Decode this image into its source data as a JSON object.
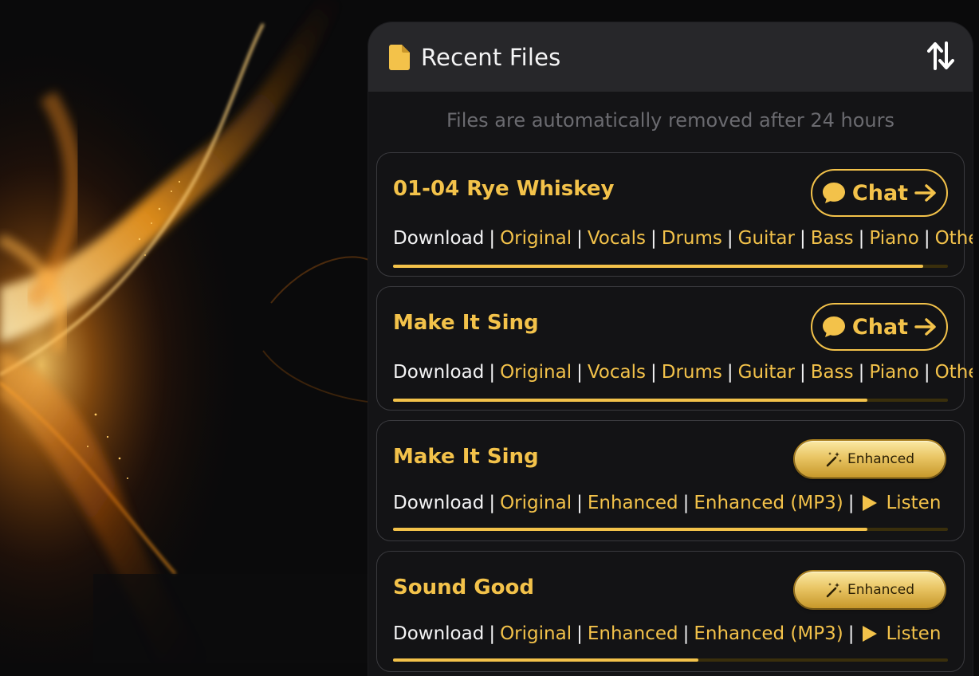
{
  "panel": {
    "title": "Recent Files",
    "notice": "Files are automatically removed after 24 hours"
  },
  "icons": {
    "file": "file-icon",
    "sort": "sort-arrows-icon",
    "chat": "chat-bubble-icon",
    "arrow": "arrow-right-icon",
    "wand": "magic-wand-icon",
    "play": "play-icon"
  },
  "colors": {
    "accent": "#f3c24a",
    "card_border": "#3a3a3e",
    "header_bg": "#27272a"
  },
  "files": [
    {
      "title": "01-04 Rye Whiskey",
      "action": "Chat",
      "links": {
        "download": "Download",
        "original": "Original",
        "vocals": "Vocals",
        "drums": "Drums",
        "guitar": "Guitar",
        "bass": "Bass",
        "piano": "Piano",
        "other": "Other"
      },
      "progress": 0.955
    },
    {
      "title": "Make It Sing",
      "action": "Chat",
      "links": {
        "download": "Download",
        "original": "Original",
        "vocals": "Vocals",
        "drums": "Drums",
        "guitar": "Guitar",
        "bass": "Bass",
        "piano": "Piano",
        "other": "Other"
      },
      "progress": 0.855
    },
    {
      "title": "Make It Sing",
      "badge": "Enhanced",
      "links": {
        "download": "Download",
        "original": "Original",
        "enhanced": "Enhanced",
        "enhanced_mp3": "Enhanced (MP3)",
        "listen": "Listen"
      },
      "progress": 0.855
    },
    {
      "title": "Sound Good",
      "badge": "Enhanced",
      "links": {
        "download": "Download",
        "original": "Original",
        "enhanced": "Enhanced",
        "enhanced_mp3": "Enhanced (MP3)",
        "listen": "Listen"
      },
      "progress": 0.55
    }
  ]
}
